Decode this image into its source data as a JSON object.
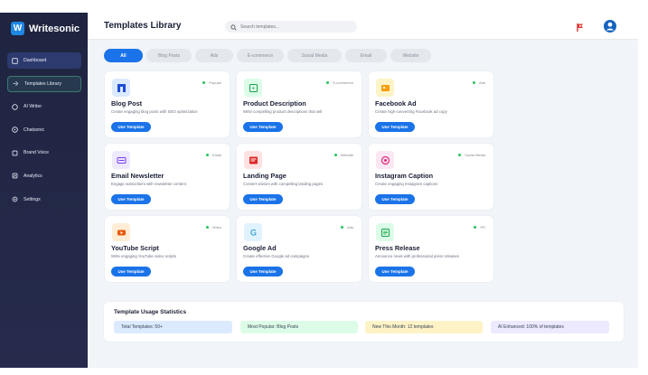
{
  "brand": {
    "logo_letter": "W",
    "name": "Writesonic"
  },
  "sidebar": {
    "items": [
      {
        "label": "Dashboard",
        "icon": "dashboard-icon",
        "state": "active"
      },
      {
        "label": "Templates Library",
        "icon": "templates-icon",
        "state": "highlight"
      },
      {
        "label": "AI Writer",
        "icon": "ai-writer-icon",
        "state": ""
      },
      {
        "label": "Chatsonic",
        "icon": "chat-icon",
        "state": ""
      },
      {
        "label": "Brand Voice",
        "icon": "brand-voice-icon",
        "state": ""
      },
      {
        "label": "Analytics",
        "icon": "analytics-icon",
        "state": ""
      },
      {
        "label": "Settings",
        "icon": "settings-icon",
        "state": ""
      }
    ]
  },
  "header": {
    "title": "Templates Library",
    "search_placeholder": "Search templates..."
  },
  "tabs": [
    {
      "label": "All",
      "active": true
    },
    {
      "label": "Blog Posts",
      "active": false
    },
    {
      "label": "Ads",
      "active": false
    },
    {
      "label": "E-commerce",
      "active": false
    },
    {
      "label": "Social Media",
      "active": false
    },
    {
      "label": "Email",
      "active": false
    },
    {
      "label": "Website",
      "active": false
    }
  ],
  "cards": [
    {
      "title": "Blog Post",
      "desc": "Create engaging blog posts with SEO optimization",
      "tag": "Popular",
      "icon": "blog-icon",
      "icon_bg": "#dbeafe",
      "icon_color": "#1d4ed8"
    },
    {
      "title": "Product Description",
      "desc": "Write compelling product descriptions that sell",
      "tag": "E-commerce",
      "icon": "product-icon",
      "icon_bg": "#dcfce7",
      "icon_color": "#16a34a"
    },
    {
      "title": "Facebook Ad",
      "desc": "Create high-converting Facebook ad copy",
      "tag": "Ads",
      "icon": "facebook-ad-icon",
      "icon_bg": "#fef3c7",
      "icon_color": "#f59e0b"
    },
    {
      "title": "Email Newsletter",
      "desc": "Engage subscribers with newsletter content",
      "tag": "Email",
      "icon": "email-icon",
      "icon_bg": "#ede9fe",
      "icon_color": "#7c3aed"
    },
    {
      "title": "Landing Page",
      "desc": "Convert visitors with compelling landing pages",
      "tag": "Website",
      "icon": "landing-page-icon",
      "icon_bg": "#fee2e2",
      "icon_color": "#dc2626"
    },
    {
      "title": "Instagram Caption",
      "desc": "Create engaging Instagram captions",
      "tag": "Social Media",
      "icon": "instagram-icon",
      "icon_bg": "#fce7f3",
      "icon_color": "#db2777"
    },
    {
      "title": "YouTube Script",
      "desc": "Write engaging YouTube video scripts",
      "tag": "Video",
      "icon": "youtube-icon",
      "icon_bg": "#ffedd5",
      "icon_color": "#ea580c"
    },
    {
      "title": "Google Ad",
      "desc": "Create effective Google ad campaigns",
      "tag": "Ads",
      "icon": "google-icon",
      "icon_bg": "#e0f2fe",
      "icon_color": "#0284c7"
    },
    {
      "title": "Press Release",
      "desc": "Announce news with professional press releases",
      "tag": "PR",
      "icon": "press-release-icon",
      "icon_bg": "#dcfce7",
      "icon_color": "#16a34a"
    }
  ],
  "use_template_label": "Use Template",
  "stats": {
    "title": "Template Usage Statistics",
    "items": [
      {
        "label": "Total Templates: 50+",
        "bg": "#dbeafe"
      },
      {
        "label": "Most Popular: Blog Posts",
        "bg": "#dcfce7"
      },
      {
        "label": "New This Month: 12 templates",
        "bg": "#fef3c7"
      },
      {
        "label": "AI Enhanced: 100% of templates",
        "bg": "#ede9fe"
      }
    ]
  },
  "colors": {
    "accent": "#1a73e8",
    "sidebar_bg": "#1f2440",
    "tag_dot": "#22c55e"
  }
}
